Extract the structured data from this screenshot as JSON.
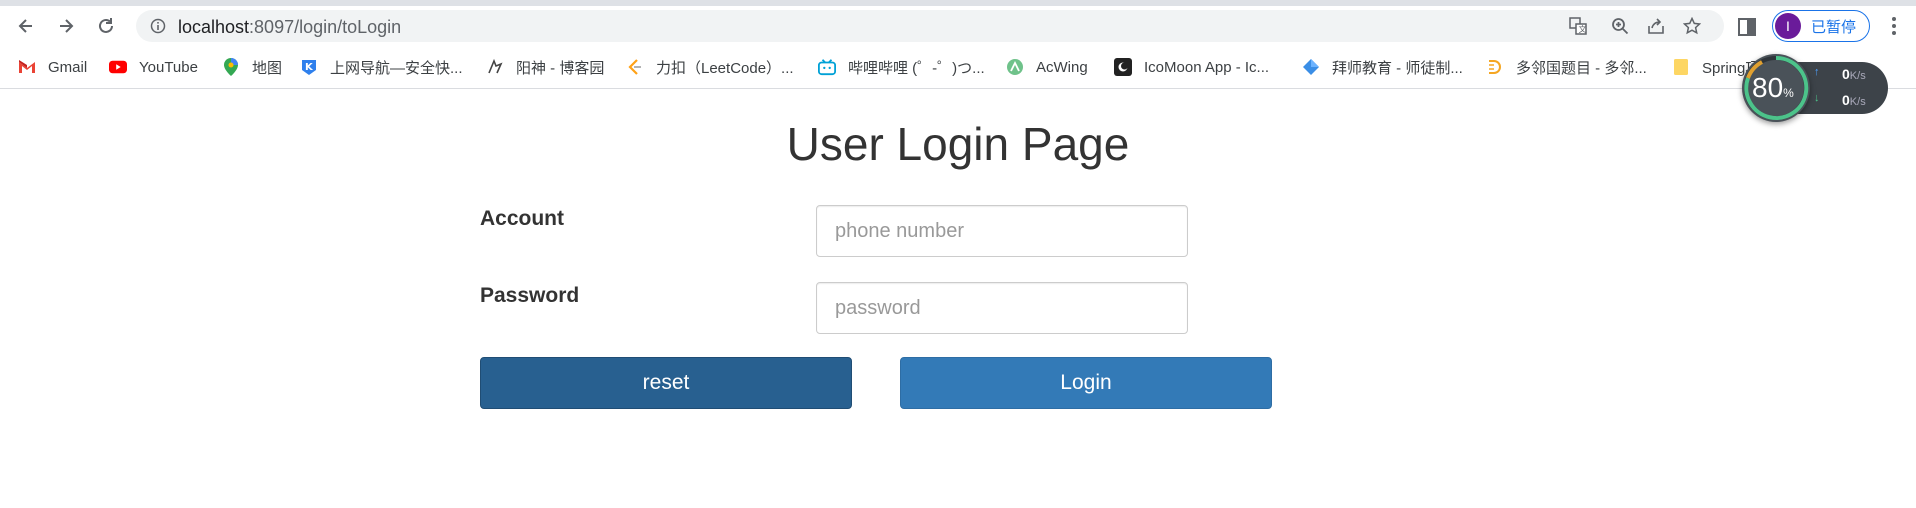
{
  "browser": {
    "url_host": "localhost",
    "url_rest": ":8097/login/toLogin",
    "profile_initial": "I",
    "profile_label": "已暂停"
  },
  "bookmarks": [
    {
      "label": "Gmail",
      "icon": "gmail-icon"
    },
    {
      "label": "YouTube",
      "icon": "youtube-icon"
    },
    {
      "label": "地图",
      "icon": "maps-icon"
    },
    {
      "label": "上网导航—安全快...",
      "icon": "k-nav-icon"
    },
    {
      "label": "阳神 - 博客园",
      "icon": "cnblogs-icon"
    },
    {
      "label": "力扣（LeetCode）...",
      "icon": "leetcode-icon"
    },
    {
      "label": "哔哩哔哩 (゜-゜)つ...",
      "icon": "bilibili-icon"
    },
    {
      "label": "AcWing",
      "icon": "acwing-icon"
    },
    {
      "label": "IcoMoon App - Ic...",
      "icon": "icomoon-icon"
    },
    {
      "label": "拜师教育 - 师徒制...",
      "icon": "diamond-icon"
    },
    {
      "label": "多邻国题目 - 多邻...",
      "icon": "duolingo-icon"
    },
    {
      "label": "Spring项目",
      "icon": "folder-icon"
    }
  ],
  "speed_widget": {
    "percent": "80",
    "percent_unit": "%",
    "upload": "0",
    "download": "0",
    "unit": "K/s"
  },
  "login": {
    "title": "User Login Page",
    "account_label": "Account",
    "account_placeholder": "phone number",
    "password_label": "Password",
    "password_placeholder": "password",
    "reset_label": "reset",
    "login_label": "Login"
  },
  "colors": {
    "reset_button": "#286090",
    "login_button": "#337ab7",
    "profile_accent": "#1a73e8"
  }
}
